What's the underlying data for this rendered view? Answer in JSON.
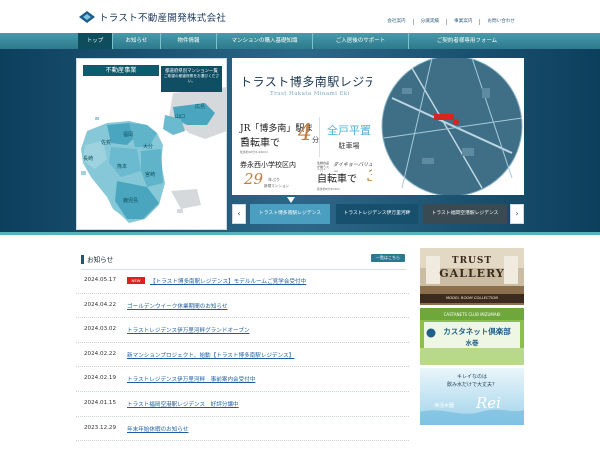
{
  "header": {
    "company": "トラスト不動産開発株式会社",
    "utility_links": [
      "会社案内",
      "分譲実績",
      "事業案内",
      "お問い合わせ"
    ]
  },
  "nav": {
    "items": [
      "トップ",
      "お知らせ",
      "物件情報",
      "マンションの購入基礎知識",
      "ご入居後のサポート",
      "ご契約者様専用フォーム"
    ],
    "active_index": 0
  },
  "map_panel": {
    "title": "不動産事業",
    "desc_line1": "都道府県別マンション一覧",
    "desc_line2": "ご希望の都道府県をお選びください。",
    "prefectures": [
      "広島",
      "山口",
      "福岡",
      "佐賀",
      "大分",
      "長崎",
      "熊本",
      "宮崎",
      "鹿児島"
    ]
  },
  "feature": {
    "title": "トラスト博多南駅レジデンス",
    "subtitle": "Trust Hakata Minami Eki",
    "jr_line1": "JR「博多南」駅まで",
    "jr_line2": "自転車で",
    "jr_minutes": "4",
    "jr_unit": "分",
    "jr_note": "徒歩約16分(1,240m)",
    "parking_line1": "全戸平置",
    "parking_line2": "駐車場",
    "school_line1": "券永西小学校区内",
    "school_years": "29",
    "school_unit": "年ぶり",
    "school_note": "新規マンション",
    "store_label": "生鮮食品が揃うスーパー",
    "store_name": "ダイキョーバリュー",
    "store_line": "自転車で",
    "store_minutes": "3",
    "store_note": "徒歩約9分(670m)"
  },
  "carousel": {
    "prev": "‹",
    "next": "›",
    "tabs": [
      "トラスト博多南駅レジデンス",
      "トラストレジデンス伊万里河畔",
      "トラスト福岡空港駅レジデンス"
    ]
  },
  "news": {
    "title": "お知らせ",
    "more_label": "一覧はこちら",
    "badge": "NEW",
    "items": [
      {
        "date": "2024.05.17",
        "title": "【トラスト博多南駅レジデンス】モデルルームご見学会受付中",
        "new": true
      },
      {
        "date": "2024.04.22",
        "title": "ゴールデンウイーク休業期間のお知らせ",
        "new": false
      },
      {
        "date": "2024.03.02",
        "title": "トラストレジデンス伊万里河畔グランドオープン",
        "new": false
      },
      {
        "date": "2024.02.22",
        "title": "新マンションプロジェクト、始動【トラスト博多南駅レジデンス】",
        "new": false
      },
      {
        "date": "2024.02.19",
        "title": "トラストレジデンス伊万里河畔　事前案内会受付中",
        "new": false
      },
      {
        "date": "2024.01.15",
        "title": "トラスト福岡空港駅レジデンス　好評分譲中",
        "new": false
      },
      {
        "date": "2023.12.29",
        "title": "年末年始休暇のお知らせ",
        "new": false
      }
    ]
  },
  "banners": {
    "gallery_line1": "TRUST",
    "gallery_line2": "GALLERY",
    "gallery_sub": "MODEL ROOM COLLECTION",
    "castanets_small": "CASTANETS CLUB MIZUMAKI",
    "castanets_main": "カスタネット倶楽部",
    "castanets_sub": "水巻",
    "water_q1": "キレイなのは",
    "water_q2": "飲み水だけで大丈夫？",
    "water_brand": "Rei",
    "water_sub": "浄活水器"
  },
  "colors": {
    "nav": "#2c7a8c",
    "nav_active": "#0e4d5c",
    "hero": "#0c3f5c",
    "link": "#1f5fa0",
    "badge": "#d9241b",
    "accent_orange": "#c57b3a"
  }
}
